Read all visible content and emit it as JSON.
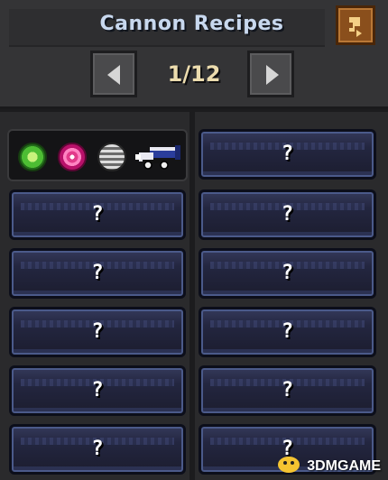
{
  "header": {
    "title": "Cannon Recipes",
    "page_indicator": "1/12",
    "back_icon": "back-arrow-icon",
    "prev_icon": "left-arrow-icon",
    "next_icon": "right-arrow-icon"
  },
  "selected_recipe": {
    "ingredients": [
      "green-gem-icon",
      "pink-gem-icon",
      "gray-gem-icon"
    ],
    "result": "cannon-icon"
  },
  "recipes": {
    "unknown_label": "?",
    "left": [
      "?",
      "?",
      "?",
      "?",
      "?"
    ],
    "right": [
      "?",
      "?",
      "?",
      "?",
      "?",
      "?"
    ]
  },
  "watermark": "3DMGAME",
  "colors": {
    "background": "#2a2a2c",
    "title_text": "#c8d8ee",
    "page_text": "#ecdcae",
    "slot_border": "#4b5a8a"
  }
}
